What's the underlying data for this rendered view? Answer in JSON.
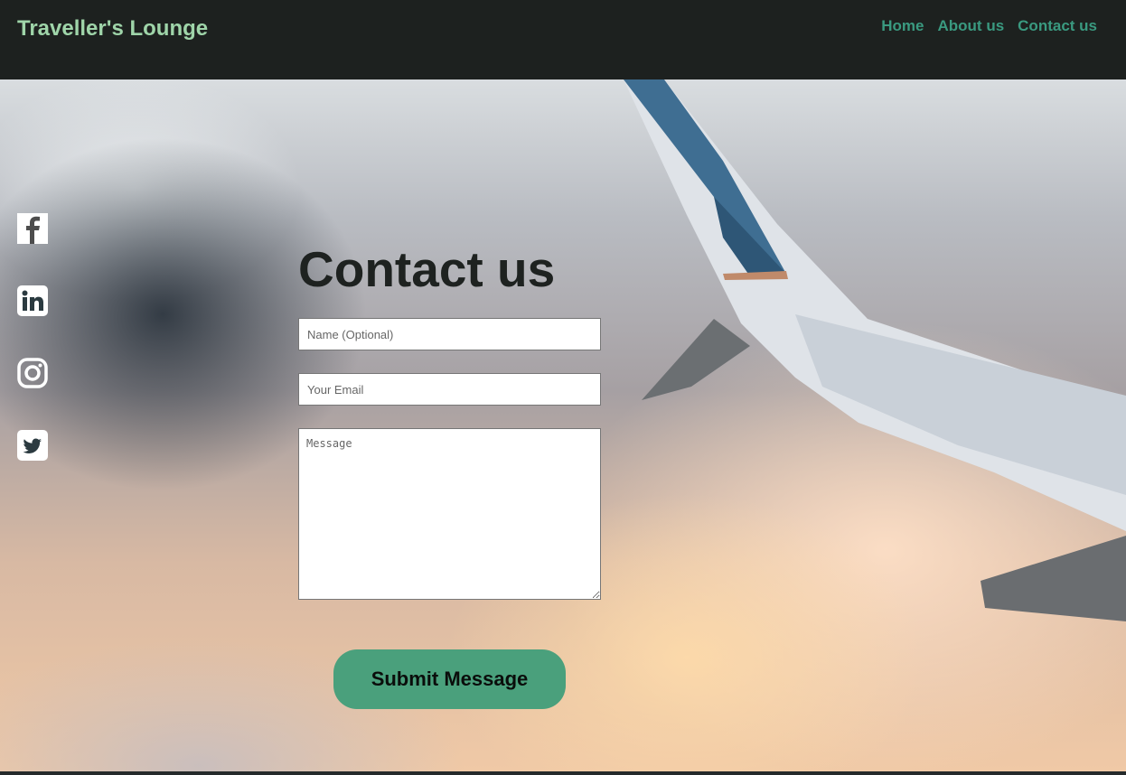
{
  "header": {
    "brand": "Traveller's Lounge",
    "nav": [
      {
        "label": "Home"
      },
      {
        "label": "About us"
      },
      {
        "label": "Contact us"
      }
    ]
  },
  "social": [
    {
      "icon": "facebook-icon"
    },
    {
      "icon": "linkedin-icon"
    },
    {
      "icon": "instagram-icon"
    },
    {
      "icon": "twitter-icon"
    }
  ],
  "contact": {
    "title": "Contact us",
    "name_placeholder": "Name (Optional)",
    "email_placeholder": "Your Email",
    "message_placeholder": "Message",
    "submit_label": "Submit Message"
  },
  "colors": {
    "brand": "#9fd5a9",
    "nav": "#3a9a80",
    "header_bg": "#1d211f",
    "button": "#4aa07c"
  }
}
